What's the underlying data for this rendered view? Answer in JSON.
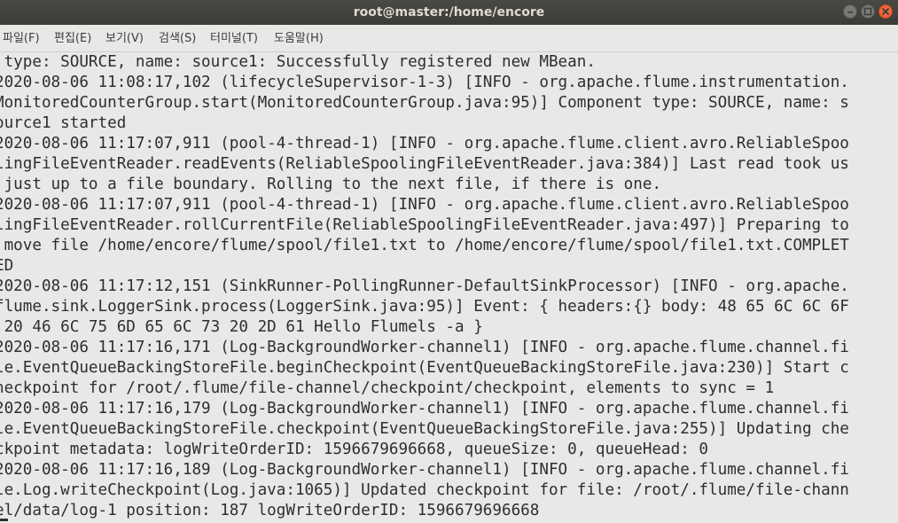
{
  "window": {
    "title": "root@master:/home/encore",
    "buttons": [
      {
        "name": "minimize",
        "icon": "minimize-icon"
      },
      {
        "name": "maximize",
        "icon": "maximize-icon"
      },
      {
        "name": "close",
        "icon": "close-icon",
        "color": "#f0663c"
      }
    ]
  },
  "menubar": {
    "items": [
      {
        "label": "파일(F)"
      },
      {
        "label": "편집(E)"
      },
      {
        "label": "보기(V)"
      },
      {
        "label": "검색(S)"
      },
      {
        "label": "터미널(T)"
      },
      {
        "label": "도움말(H)"
      }
    ]
  },
  "terminal": {
    "background": "#e8e8e7",
    "foreground": "#2e2e2e",
    "lines": [
      " type: SOURCE, name: source1: Successfully registered new MBean.",
      "2020-08-06 11:08:17,102 (lifecycleSupervisor-1-3) [INFO - org.apache.flume.instrumentation.",
      "MonitoredCounterGroup.start(MonitoredCounterGroup.java:95)] Component type: SOURCE, name: s",
      "ource1 started",
      "2020-08-06 11:17:07,911 (pool-4-thread-1) [INFO - org.apache.flume.client.avro.ReliableSpoo",
      "lingFileEventReader.readEvents(ReliableSpoolingFileEventReader.java:384)] Last read took us",
      " just up to a file boundary. Rolling to the next file, if there is one.",
      "2020-08-06 11:17:07,911 (pool-4-thread-1) [INFO - org.apache.flume.client.avro.ReliableSpoo",
      "lingFileEventReader.rollCurrentFile(ReliableSpoolingFileEventReader.java:497)] Preparing to",
      " move file /home/encore/flume/spool/file1.txt to /home/encore/flume/spool/file1.txt.COMPLET",
      "ED",
      "2020-08-06 11:17:12,151 (SinkRunner-PollingRunner-DefaultSinkProcessor) [INFO - org.apache.",
      "flume.sink.LoggerSink.process(LoggerSink.java:95)] Event: { headers:{} body: 48 65 6C 6C 6F",
      " 20 46 6C 75 6D 65 6C 73 20 2D 61 Hello Flumels -a }",
      "2020-08-06 11:17:16,171 (Log-BackgroundWorker-channel1) [INFO - org.apache.flume.channel.fi",
      "le.EventQueueBackingStoreFile.beginCheckpoint(EventQueueBackingStoreFile.java:230)] Start c",
      "heckpoint for /root/.flume/file-channel/checkpoint/checkpoint, elements to sync = 1",
      "2020-08-06 11:17:16,179 (Log-BackgroundWorker-channel1) [INFO - org.apache.flume.channel.fi",
      "le.EventQueueBackingStoreFile.checkpoint(EventQueueBackingStoreFile.java:255)] Updating che",
      "ckpoint metadata: logWriteOrderID: 1596679696668, queueSize: 0, queueHead: 0",
      "2020-08-06 11:17:16,189 (Log-BackgroundWorker-channel1) [INFO - org.apache.flume.channel.fi",
      "le.Log.writeCheckpoint(Log.java:1065)] Updated checkpoint for file: /root/.flume/file-chann",
      "el/data/log-1 position: 187 logWriteOrderID: 1596679696668"
    ]
  }
}
